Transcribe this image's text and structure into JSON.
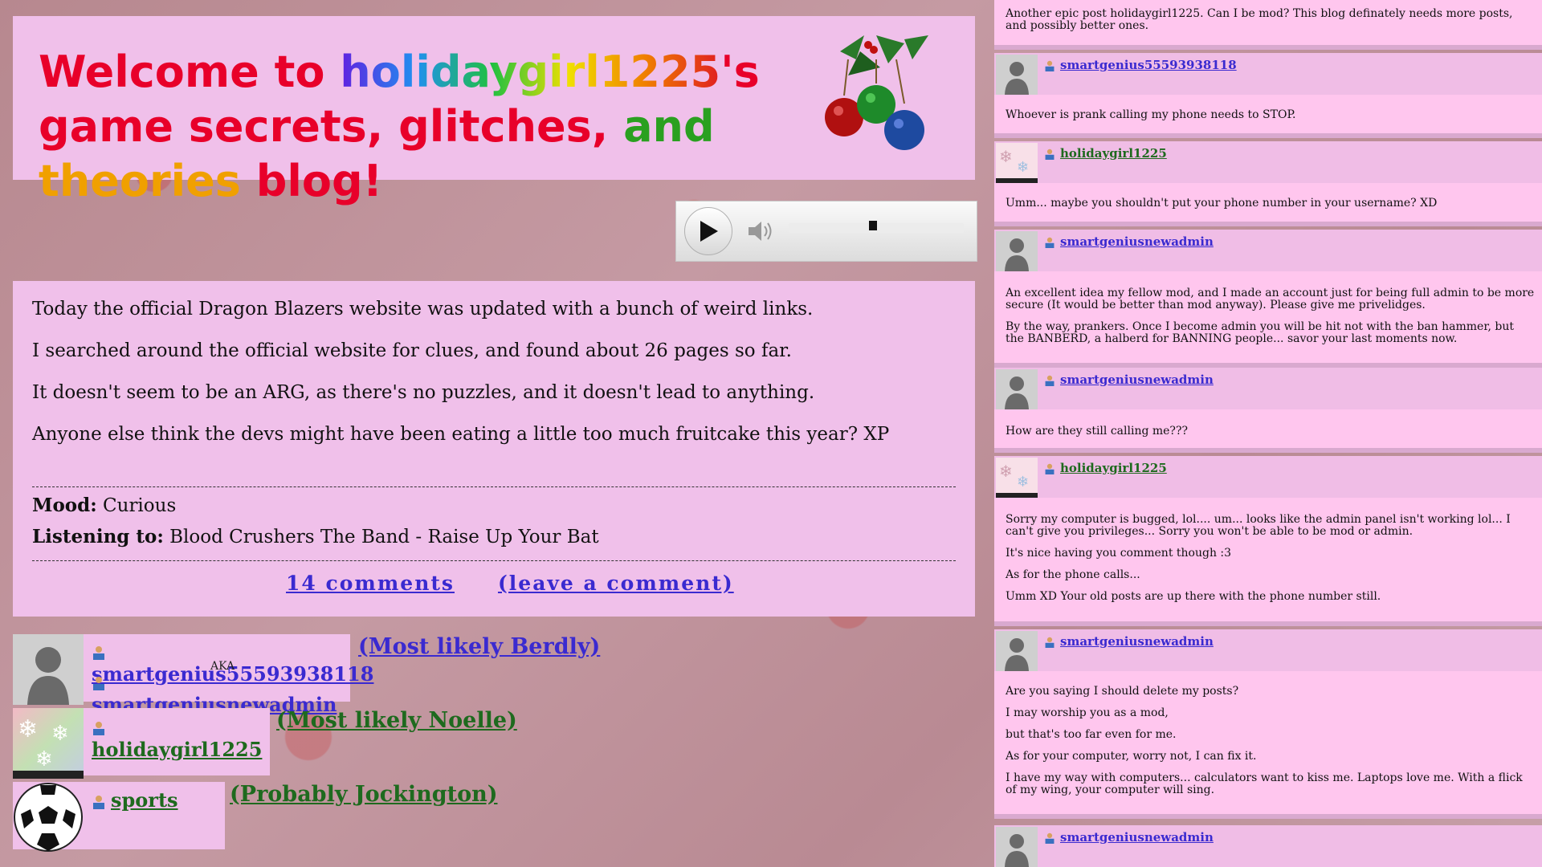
{
  "header": {
    "title_parts": [
      "Welcome to ",
      "holidaygirl1225",
      "'s game secrets, glitches, ",
      "and ",
      "theories ",
      "blog!"
    ]
  },
  "player": {
    "state": "paused",
    "progress": 0.48
  },
  "post": {
    "paragraphs": [
      "Today the official Dragon Blazers website was updated with a bunch of weird links.",
      "I searched around the official website for clues, and found about 26 pages so far.",
      "It doesn't seem to be an ARG, as there's no puzzles, and it doesn't lead to anything.",
      "Anyone else think the devs might have been eating a little too much fruitcake this year? XP"
    ],
    "mood_label": "Mood:",
    "mood": "Curious",
    "listening_label": "Listening to:",
    "listening": "Blood Crushers The Band - Raise Up Your Bat",
    "comments_link": "14 comments",
    "leave_comment_link": "(leave a comment)"
  },
  "users": {
    "u1": "smartgenius55593938118",
    "aka": "AKA",
    "u1_alt": "smartgeniusnewadmin",
    "u1_guess": "(Most likely Berdly)",
    "u2": "holidaygirl1225",
    "u2_guess": "(Most likely Noelle)",
    "u3": "sports",
    "u3_guess": "(Probably Jockington)"
  },
  "comments": {
    "top_text": "Another epic post holidaygirl1225. Can I be mod? This blog definately needs more posts, and possibly better ones.",
    "c1": {
      "name": "smartgenius55593938118",
      "lines": [
        "Whoever is prank calling my phone needs to STOP."
      ]
    },
    "c2": {
      "name": "holidaygirl1225",
      "lines": [
        "Umm... maybe you shouldn't put your phone number in your username? XD"
      ]
    },
    "c3": {
      "name": "smartgeniusnewadmin",
      "lines": [
        "An excellent idea my fellow mod, and I made an account just for being full admin to be more secure (It would be better than mod anyway). Please give me privelidges.",
        "By the way, prankers. Once I become admin you will be hit not with the ban hammer, but the BANBERD, a halberd for BANNING people... savor your last moments now."
      ]
    },
    "c4": {
      "name": "smartgeniusnewadmin",
      "lines": [
        "How are they still calling me???"
      ]
    },
    "c5": {
      "name": "holidaygirl1225",
      "lines": [
        "Sorry my computer is bugged, lol.... um... looks like the admin panel isn't working lol... I can't give you privileges... Sorry you won't be able to be mod or admin.",
        "It's nice having you comment though :3",
        "As for the phone calls...",
        "Umm XD Your old posts are up there with the phone number still."
      ]
    },
    "c6": {
      "name": "smartgeniusnewadmin",
      "lines": [
        "Are you saying I should delete my posts?",
        "I may worship you as a mod,",
        "but that's too far even for me.",
        "As for your computer, worry not, I can fix it.",
        "I have my way with computers... calculators want to kiss me. Laptops love me. With a flick of my wing, your computer will sing."
      ]
    },
    "c7": {
      "name": "smartgeniusnewadmin"
    }
  },
  "colors": {
    "panel": "#f0c0ea",
    "link_blue": "#3a2ad0",
    "link_green": "#1e6a1e"
  }
}
